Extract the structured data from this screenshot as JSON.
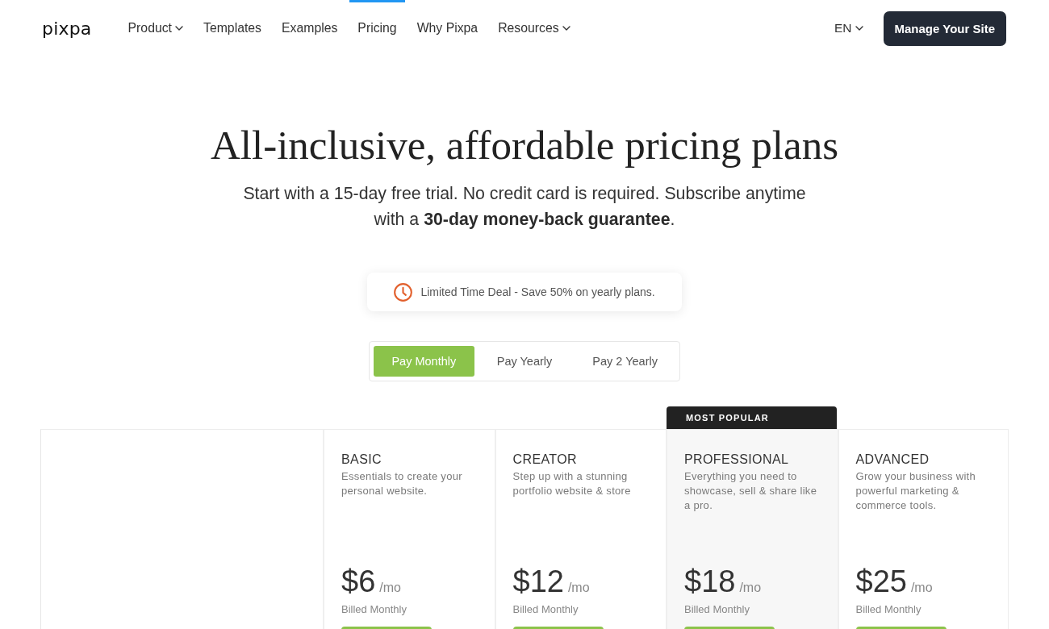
{
  "nav": {
    "logo": "pixpa",
    "items": [
      {
        "label": "Product",
        "dropdown": true,
        "selected": false
      },
      {
        "label": "Templates",
        "dropdown": false,
        "selected": false
      },
      {
        "label": "Examples",
        "dropdown": false,
        "selected": false
      },
      {
        "label": "Pricing",
        "dropdown": false,
        "selected": true
      },
      {
        "label": "Why Pixpa",
        "dropdown": false,
        "selected": false
      },
      {
        "label": "Resources",
        "dropdown": true,
        "selected": false
      }
    ],
    "language": "EN",
    "cta": "Manage Your Site"
  },
  "hero": {
    "title": "All-inclusive, affordable pricing plans",
    "subtitle": "Start with a 15-day free trial. No credit card is required. Subscribe anytime with a **30-day money-back guarantee**."
  },
  "deal": {
    "text": "Limited Time Deal - Save 50% on yearly plans."
  },
  "billing_tabs": [
    {
      "label": "Pay Monthly",
      "selected": true
    },
    {
      "label": "Pay Yearly",
      "selected": false
    },
    {
      "label": "Pay 2 Yearly",
      "selected": false
    }
  ],
  "plans": [
    {
      "name": "BASIC",
      "description": "Essentials to create your personal website.",
      "price": "$6",
      "period": "/mo",
      "billing": "Billed Monthly"
    },
    {
      "name": "CREATOR",
      "description": "Step up with a stunning portfolio website & store",
      "price": "$12",
      "period": "/mo",
      "billing": "Billed Monthly"
    },
    {
      "name": "PROFESSIONAL",
      "badge": "MOST POPULAR",
      "description": "Everything you need to showcase, sell & share like a pro.",
      "price": "$18",
      "period": "/mo",
      "billing": "Billed Monthly"
    },
    {
      "name": "ADVANCED",
      "description": "Grow your business with powerful marketing & commerce tools.",
      "price": "$25",
      "period": "/mo",
      "billing": "Billed Monthly"
    }
  ]
}
